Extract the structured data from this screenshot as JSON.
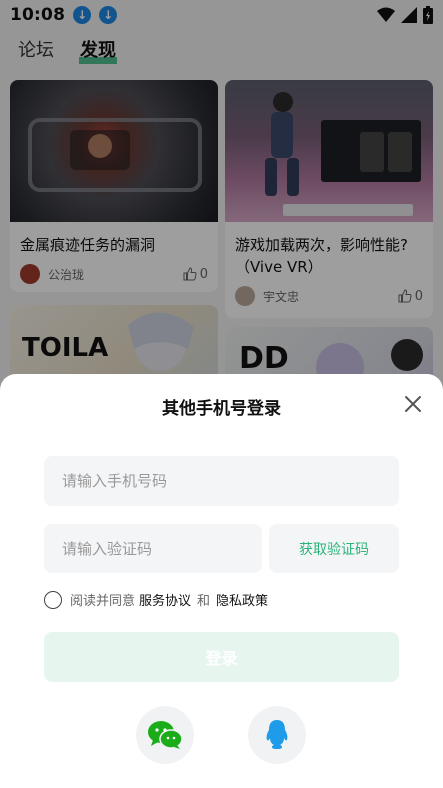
{
  "status": {
    "time": "10:08"
  },
  "tabs": [
    {
      "label": "论坛"
    },
    {
      "label": "发现"
    }
  ],
  "cards": [
    {
      "title": "金属痕迹任务的漏洞",
      "author": "公治珑",
      "likes": "0"
    },
    {
      "title": "游戏加载两次，影响性能?（Vive VR）",
      "author": "宇文忠",
      "likes": "0"
    },
    {
      "image_text": "TOILA"
    },
    {
      "image_text": "DD"
    }
  ],
  "login_sheet": {
    "title": "其他手机号登录",
    "phone_placeholder": "请输入手机号码",
    "code_placeholder": "请输入验证码",
    "get_code_label": "获取验证码",
    "agree_prefix": "阅读并同意",
    "service_link": "服务协议",
    "and_text": "和",
    "privacy_link": "隐私政策",
    "login_label": "登录"
  },
  "colors": {
    "accent": "#2bb37b",
    "wechat": "#1aad19",
    "qq": "#1e9be9"
  },
  "icons": [
    "download-icon",
    "wifi-icon",
    "signal-icon",
    "battery-icon",
    "close-icon",
    "thumb-up-icon",
    "wechat-icon",
    "qq-icon"
  ]
}
